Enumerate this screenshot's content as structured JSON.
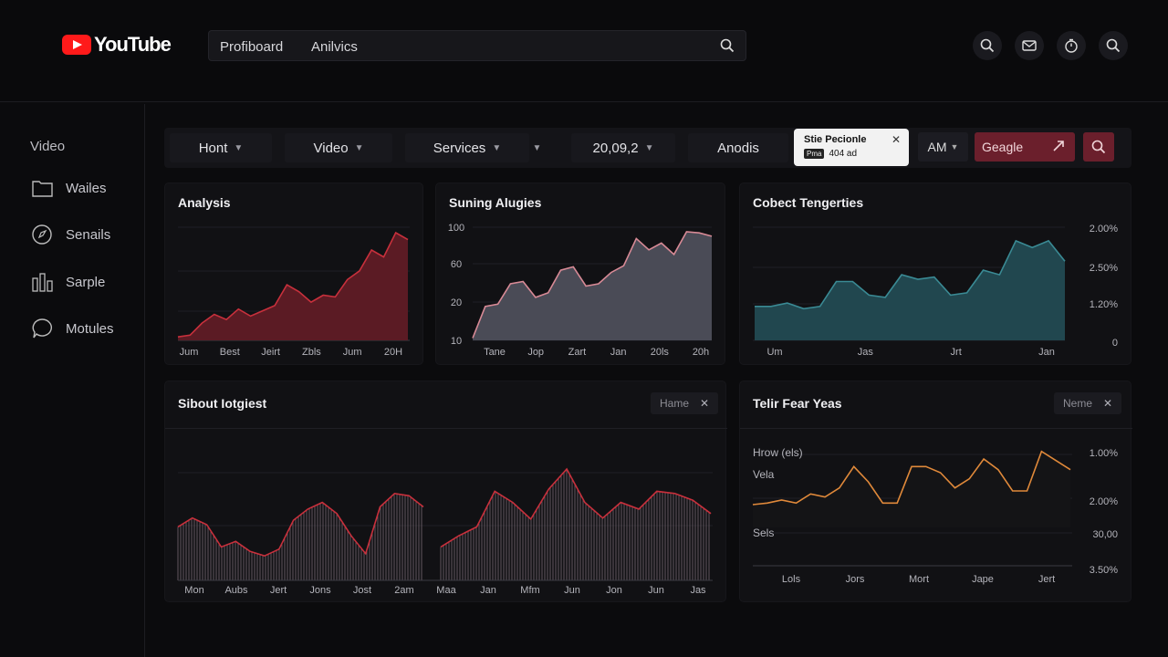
{
  "header": {
    "logo_text": "YouTube",
    "search": {
      "term1": "Profiboard",
      "term2": "Anilvics"
    },
    "icons": [
      "search-icon",
      "mail-icon",
      "timer-icon",
      "search-icon"
    ]
  },
  "sidebar": {
    "title": "Video",
    "items": [
      {
        "label": "Wailes",
        "icon": "folder-icon"
      },
      {
        "label": "Senails",
        "icon": "compass-icon"
      },
      {
        "label": "Sarple",
        "icon": "bar-chart-icon"
      },
      {
        "label": "Motules",
        "icon": "chat-icon"
      }
    ]
  },
  "filters": {
    "items": [
      {
        "label": "Hont"
      },
      {
        "label": "Video"
      },
      {
        "label": "Services"
      },
      {
        "label": ""
      },
      {
        "label": "20,09,2"
      },
      {
        "label": "Anodis"
      }
    ],
    "popup": {
      "title": "Stie Pecionle",
      "tag": "Pma",
      "value": "404 ad"
    },
    "am_label": "AM",
    "google_label": "Geagle"
  },
  "colors": {
    "accent": "#6b1f2c",
    "red": "#c8303c",
    "slate": "#c4818c",
    "teal": "#3a8a94",
    "orange": "#e0893a"
  },
  "cards": {
    "analysis": {
      "title": "Analysis"
    },
    "suning": {
      "title": "Suning Alugies"
    },
    "cobect": {
      "title": "Cobect Tengerties"
    },
    "sibout": {
      "title": "Sibout Iotgiest",
      "chip": "Hame"
    },
    "telir": {
      "title": "Telir Fear Yeas",
      "chip": "Neme"
    }
  },
  "chart_data": [
    {
      "type": "area",
      "title": "Analysis",
      "x": [
        "Jum",
        "Best",
        "Jeirt",
        "Zbls",
        "Jum",
        "20H"
      ],
      "series": [
        {
          "values": [
            2,
            3,
            10,
            15,
            12,
            18,
            14,
            17,
            20,
            32,
            28,
            22,
            26,
            25,
            35,
            40,
            52,
            48,
            62,
            58
          ]
        }
      ]
    },
    {
      "type": "area",
      "title": "Suning Alugies",
      "x": [
        "Tane",
        "Jop",
        "Zart",
        "Jan",
        "20ls",
        "20h"
      ],
      "yticks": [
        "100",
        "60",
        "20",
        "10"
      ],
      "series": [
        {
          "values": [
            2,
            30,
            32,
            50,
            52,
            38,
            42,
            62,
            65,
            48,
            50,
            60,
            66,
            90,
            80,
            86,
            76,
            96,
            95,
            92
          ]
        }
      ]
    },
    {
      "type": "area",
      "title": "Cobect Tengerties",
      "x": [
        "Um",
        "Jas",
        "Jrt",
        "Jan"
      ],
      "yticks": [
        "2.00%",
        "2.50%",
        "1.20%",
        "0"
      ],
      "series": [
        {
          "values": [
            30,
            30,
            33,
            28,
            30,
            52,
            52,
            40,
            38,
            58,
            54,
            56,
            40,
            42,
            62,
            58,
            88,
            82,
            88,
            70
          ]
        }
      ]
    },
    {
      "type": "area",
      "title": "Sibout Iotgiest",
      "x": [
        "Mon",
        "Aubs",
        "Jert",
        "Jons",
        "Jost",
        "2am",
        "Maa",
        "Jan",
        "Mfm",
        "Jun",
        "Jon",
        "Jun",
        "Jas"
      ],
      "series": [
        {
          "values": [
            48,
            56,
            50,
            30,
            35,
            26,
            22,
            28,
            54,
            64,
            70,
            60,
            40,
            24,
            66,
            78,
            76,
            66
          ]
        },
        {
          "values": [
            30,
            40,
            48,
            80,
            70,
            55,
            82,
            100,
            70,
            56,
            70,
            64,
            80,
            78,
            72,
            60
          ]
        }
      ]
    },
    {
      "type": "line",
      "title": "Telir Fear Yeas",
      "x": [
        "Lols",
        "Jors",
        "Mort",
        "Jape",
        "Jert"
      ],
      "yticks": [
        "1.00%",
        "2.00%",
        "30,00",
        "3.50%"
      ],
      "annotations": [
        "Hrow (els)",
        "Vela",
        "Sels"
      ],
      "series": [
        {
          "values": [
            15,
            16,
            18,
            16,
            22,
            20,
            26,
            40,
            30,
            16,
            16,
            40,
            40,
            36,
            26,
            32,
            45,
            38,
            24,
            24,
            50,
            44,
            38
          ]
        }
      ]
    }
  ]
}
